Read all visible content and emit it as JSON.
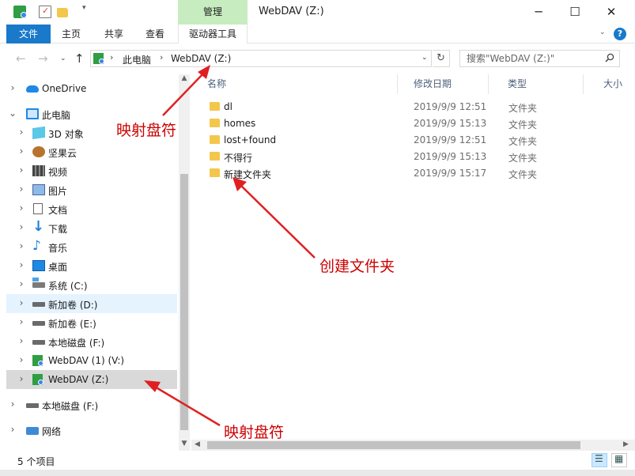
{
  "titlebar": {
    "manage_tab": "管理",
    "window_title": "WebDAV (Z:)",
    "minimize": "─",
    "maximize": "☐",
    "close": "✕"
  },
  "ribbon": {
    "tabs": [
      "文件",
      "主页",
      "共享",
      "查看",
      "驱动器工具"
    ],
    "help": "?"
  },
  "address": {
    "crumbs": [
      "此电脑",
      "WebDAV (Z:)"
    ],
    "search_placeholder": "搜索\"WebDAV (Z:)\""
  },
  "nav_pane": {
    "items": [
      {
        "label": "OneDrive",
        "icon": "onedrive-icon"
      },
      {
        "label": "此电脑",
        "icon": "computer-icon"
      },
      {
        "label": "3D 对象",
        "icon": "3d-objects-icon"
      },
      {
        "label": "坚果云",
        "icon": "nutstore-icon"
      },
      {
        "label": "视频",
        "icon": "video-icon"
      },
      {
        "label": "图片",
        "icon": "pictures-icon"
      },
      {
        "label": "文档",
        "icon": "documents-icon"
      },
      {
        "label": "下载",
        "icon": "downloads-icon"
      },
      {
        "label": "音乐",
        "icon": "music-icon"
      },
      {
        "label": "桌面",
        "icon": "desktop-icon"
      },
      {
        "label": "系统 (C:)",
        "icon": "system-drive-icon"
      },
      {
        "label": "新加卷 (D:)",
        "icon": "drive-icon"
      },
      {
        "label": "新加卷 (E:)",
        "icon": "drive-icon"
      },
      {
        "label": "本地磁盘 (F:)",
        "icon": "drive-icon"
      },
      {
        "label": "WebDAV (1) (V:)",
        "icon": "network-drive-icon"
      },
      {
        "label": "WebDAV (Z:)",
        "icon": "network-drive-icon"
      },
      {
        "label": "本地磁盘 (F:)",
        "icon": "drive-icon"
      },
      {
        "label": "网络",
        "icon": "network-icon"
      }
    ]
  },
  "file_list": {
    "columns": [
      "名称",
      "修改日期",
      "类型",
      "大小"
    ],
    "rows": [
      {
        "name": "dl",
        "date": "2019/9/9 12:51",
        "type": "文件夹"
      },
      {
        "name": "homes",
        "date": "2019/9/9 15:13",
        "type": "文件夹"
      },
      {
        "name": "lost+found",
        "date": "2019/9/9 12:51",
        "type": "文件夹"
      },
      {
        "name": "不得行",
        "date": "2019/9/9 15:13",
        "type": "文件夹"
      },
      {
        "name": "新建文件夹",
        "date": "2019/9/9 15:17",
        "type": "文件夹"
      }
    ]
  },
  "status": {
    "item_count": "5 个项目"
  },
  "annotations": {
    "top": "映射盘符",
    "middle": "创建文件夹",
    "bottom": "映射盘符",
    "color": "#e02020"
  }
}
